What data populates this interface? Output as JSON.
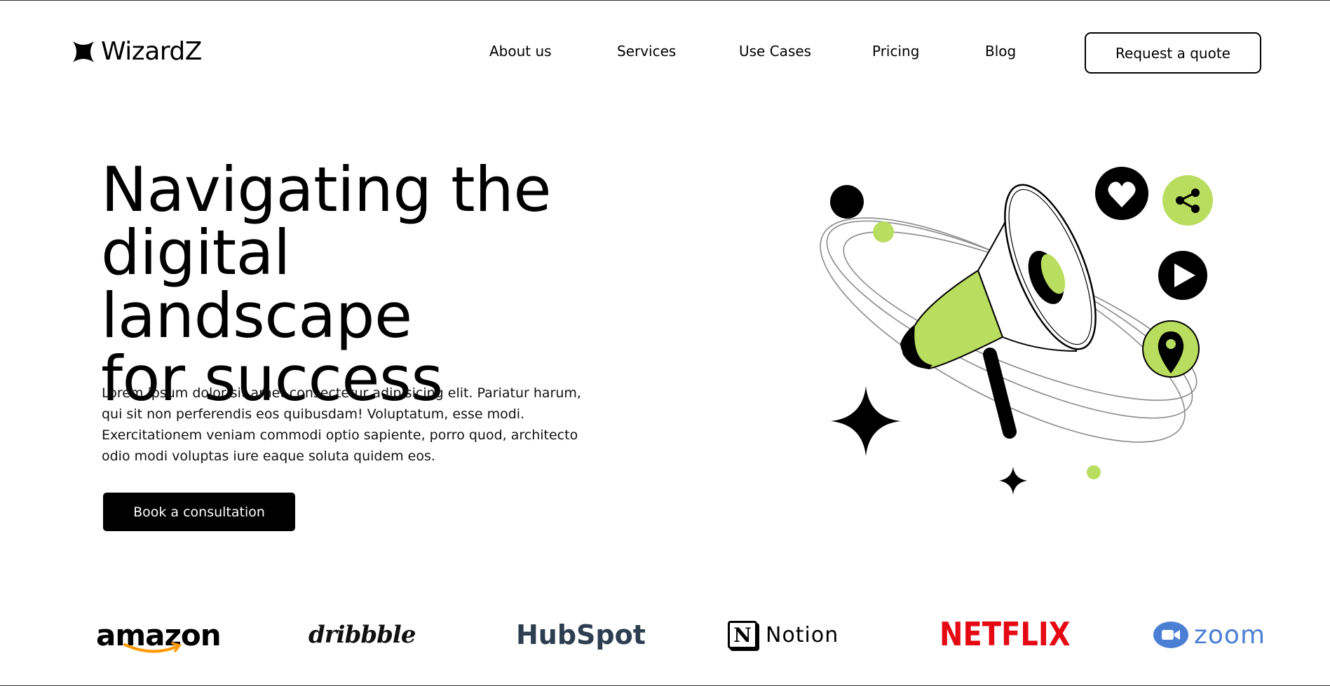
{
  "brand": {
    "name": "WizardZ"
  },
  "nav": {
    "items": [
      "About us",
      "Services",
      "Use Cases",
      "Pricing",
      "Blog"
    ],
    "quote_button": "Request a quote"
  },
  "hero": {
    "title_lines": [
      "Navigating the",
      "digital landscape",
      "for success"
    ],
    "body": "Lorem ipsum dolor sit amet consectetur adipisicing elit. Pariatur harum, qui sit non perferendis eos quibusdam! Voluptatum, esse modi. Exercitationem veniam commodi optio sapiente, porro quod, architecto odio modi voluptas iure eaque soluta quidem eos.",
    "cta": "Book a consultation",
    "illustration": "megaphone-illustration"
  },
  "partners": {
    "amazon": "amazon",
    "dribbble": "dribbble",
    "hubspot": "HubSpot",
    "notion_mark": "N",
    "notion": "Notion",
    "netflix": "NETFLIX",
    "zoom": "zoom"
  },
  "colors": {
    "accent": "#b9dd5f",
    "dark": "#000000",
    "hubspot_orange": "#ff7a59",
    "netflix_red": "#e50914",
    "zoom_blue": "#4a7fd4",
    "amazon_orange": "#ff9900"
  }
}
